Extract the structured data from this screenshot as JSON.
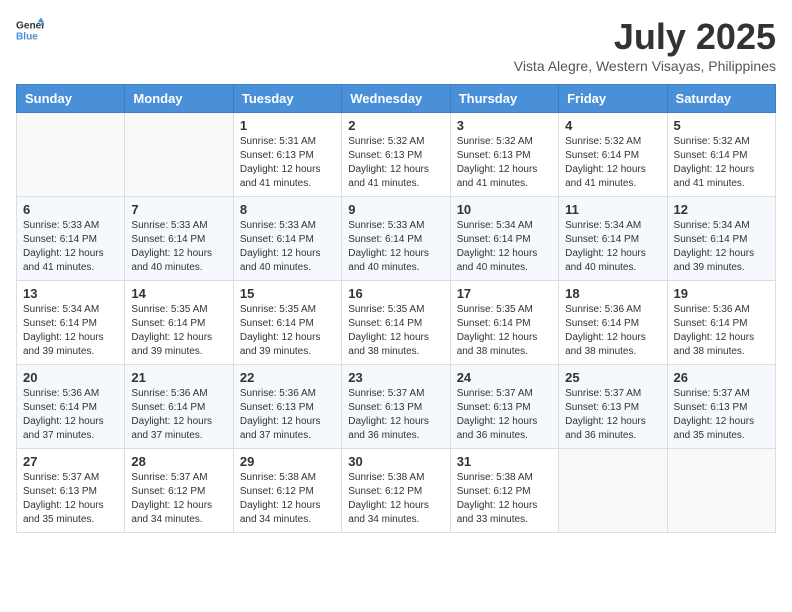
{
  "logo": {
    "line1": "General",
    "line2": "Blue"
  },
  "title": "July 2025",
  "subtitle": "Vista Alegre, Western Visayas, Philippines",
  "days_of_week": [
    "Sunday",
    "Monday",
    "Tuesday",
    "Wednesday",
    "Thursday",
    "Friday",
    "Saturday"
  ],
  "weeks": [
    [
      {
        "day": "",
        "sunrise": "",
        "sunset": "",
        "daylight": ""
      },
      {
        "day": "",
        "sunrise": "",
        "sunset": "",
        "daylight": ""
      },
      {
        "day": "1",
        "sunrise": "Sunrise: 5:31 AM",
        "sunset": "Sunset: 6:13 PM",
        "daylight": "Daylight: 12 hours and 41 minutes."
      },
      {
        "day": "2",
        "sunrise": "Sunrise: 5:32 AM",
        "sunset": "Sunset: 6:13 PM",
        "daylight": "Daylight: 12 hours and 41 minutes."
      },
      {
        "day": "3",
        "sunrise": "Sunrise: 5:32 AM",
        "sunset": "Sunset: 6:13 PM",
        "daylight": "Daylight: 12 hours and 41 minutes."
      },
      {
        "day": "4",
        "sunrise": "Sunrise: 5:32 AM",
        "sunset": "Sunset: 6:14 PM",
        "daylight": "Daylight: 12 hours and 41 minutes."
      },
      {
        "day": "5",
        "sunrise": "Sunrise: 5:32 AM",
        "sunset": "Sunset: 6:14 PM",
        "daylight": "Daylight: 12 hours and 41 minutes."
      }
    ],
    [
      {
        "day": "6",
        "sunrise": "Sunrise: 5:33 AM",
        "sunset": "Sunset: 6:14 PM",
        "daylight": "Daylight: 12 hours and 41 minutes."
      },
      {
        "day": "7",
        "sunrise": "Sunrise: 5:33 AM",
        "sunset": "Sunset: 6:14 PM",
        "daylight": "Daylight: 12 hours and 40 minutes."
      },
      {
        "day": "8",
        "sunrise": "Sunrise: 5:33 AM",
        "sunset": "Sunset: 6:14 PM",
        "daylight": "Daylight: 12 hours and 40 minutes."
      },
      {
        "day": "9",
        "sunrise": "Sunrise: 5:33 AM",
        "sunset": "Sunset: 6:14 PM",
        "daylight": "Daylight: 12 hours and 40 minutes."
      },
      {
        "day": "10",
        "sunrise": "Sunrise: 5:34 AM",
        "sunset": "Sunset: 6:14 PM",
        "daylight": "Daylight: 12 hours and 40 minutes."
      },
      {
        "day": "11",
        "sunrise": "Sunrise: 5:34 AM",
        "sunset": "Sunset: 6:14 PM",
        "daylight": "Daylight: 12 hours and 40 minutes."
      },
      {
        "day": "12",
        "sunrise": "Sunrise: 5:34 AM",
        "sunset": "Sunset: 6:14 PM",
        "daylight": "Daylight: 12 hours and 39 minutes."
      }
    ],
    [
      {
        "day": "13",
        "sunrise": "Sunrise: 5:34 AM",
        "sunset": "Sunset: 6:14 PM",
        "daylight": "Daylight: 12 hours and 39 minutes."
      },
      {
        "day": "14",
        "sunrise": "Sunrise: 5:35 AM",
        "sunset": "Sunset: 6:14 PM",
        "daylight": "Daylight: 12 hours and 39 minutes."
      },
      {
        "day": "15",
        "sunrise": "Sunrise: 5:35 AM",
        "sunset": "Sunset: 6:14 PM",
        "daylight": "Daylight: 12 hours and 39 minutes."
      },
      {
        "day": "16",
        "sunrise": "Sunrise: 5:35 AM",
        "sunset": "Sunset: 6:14 PM",
        "daylight": "Daylight: 12 hours and 38 minutes."
      },
      {
        "day": "17",
        "sunrise": "Sunrise: 5:35 AM",
        "sunset": "Sunset: 6:14 PM",
        "daylight": "Daylight: 12 hours and 38 minutes."
      },
      {
        "day": "18",
        "sunrise": "Sunrise: 5:36 AM",
        "sunset": "Sunset: 6:14 PM",
        "daylight": "Daylight: 12 hours and 38 minutes."
      },
      {
        "day": "19",
        "sunrise": "Sunrise: 5:36 AM",
        "sunset": "Sunset: 6:14 PM",
        "daylight": "Daylight: 12 hours and 38 minutes."
      }
    ],
    [
      {
        "day": "20",
        "sunrise": "Sunrise: 5:36 AM",
        "sunset": "Sunset: 6:14 PM",
        "daylight": "Daylight: 12 hours and 37 minutes."
      },
      {
        "day": "21",
        "sunrise": "Sunrise: 5:36 AM",
        "sunset": "Sunset: 6:14 PM",
        "daylight": "Daylight: 12 hours and 37 minutes."
      },
      {
        "day": "22",
        "sunrise": "Sunrise: 5:36 AM",
        "sunset": "Sunset: 6:13 PM",
        "daylight": "Daylight: 12 hours and 37 minutes."
      },
      {
        "day": "23",
        "sunrise": "Sunrise: 5:37 AM",
        "sunset": "Sunset: 6:13 PM",
        "daylight": "Daylight: 12 hours and 36 minutes."
      },
      {
        "day": "24",
        "sunrise": "Sunrise: 5:37 AM",
        "sunset": "Sunset: 6:13 PM",
        "daylight": "Daylight: 12 hours and 36 minutes."
      },
      {
        "day": "25",
        "sunrise": "Sunrise: 5:37 AM",
        "sunset": "Sunset: 6:13 PM",
        "daylight": "Daylight: 12 hours and 36 minutes."
      },
      {
        "day": "26",
        "sunrise": "Sunrise: 5:37 AM",
        "sunset": "Sunset: 6:13 PM",
        "daylight": "Daylight: 12 hours and 35 minutes."
      }
    ],
    [
      {
        "day": "27",
        "sunrise": "Sunrise: 5:37 AM",
        "sunset": "Sunset: 6:13 PM",
        "daylight": "Daylight: 12 hours and 35 minutes."
      },
      {
        "day": "28",
        "sunrise": "Sunrise: 5:37 AM",
        "sunset": "Sunset: 6:12 PM",
        "daylight": "Daylight: 12 hours and 34 minutes."
      },
      {
        "day": "29",
        "sunrise": "Sunrise: 5:38 AM",
        "sunset": "Sunset: 6:12 PM",
        "daylight": "Daylight: 12 hours and 34 minutes."
      },
      {
        "day": "30",
        "sunrise": "Sunrise: 5:38 AM",
        "sunset": "Sunset: 6:12 PM",
        "daylight": "Daylight: 12 hours and 34 minutes."
      },
      {
        "day": "31",
        "sunrise": "Sunrise: 5:38 AM",
        "sunset": "Sunset: 6:12 PM",
        "daylight": "Daylight: 12 hours and 33 minutes."
      },
      {
        "day": "",
        "sunrise": "",
        "sunset": "",
        "daylight": ""
      },
      {
        "day": "",
        "sunrise": "",
        "sunset": "",
        "daylight": ""
      }
    ]
  ]
}
